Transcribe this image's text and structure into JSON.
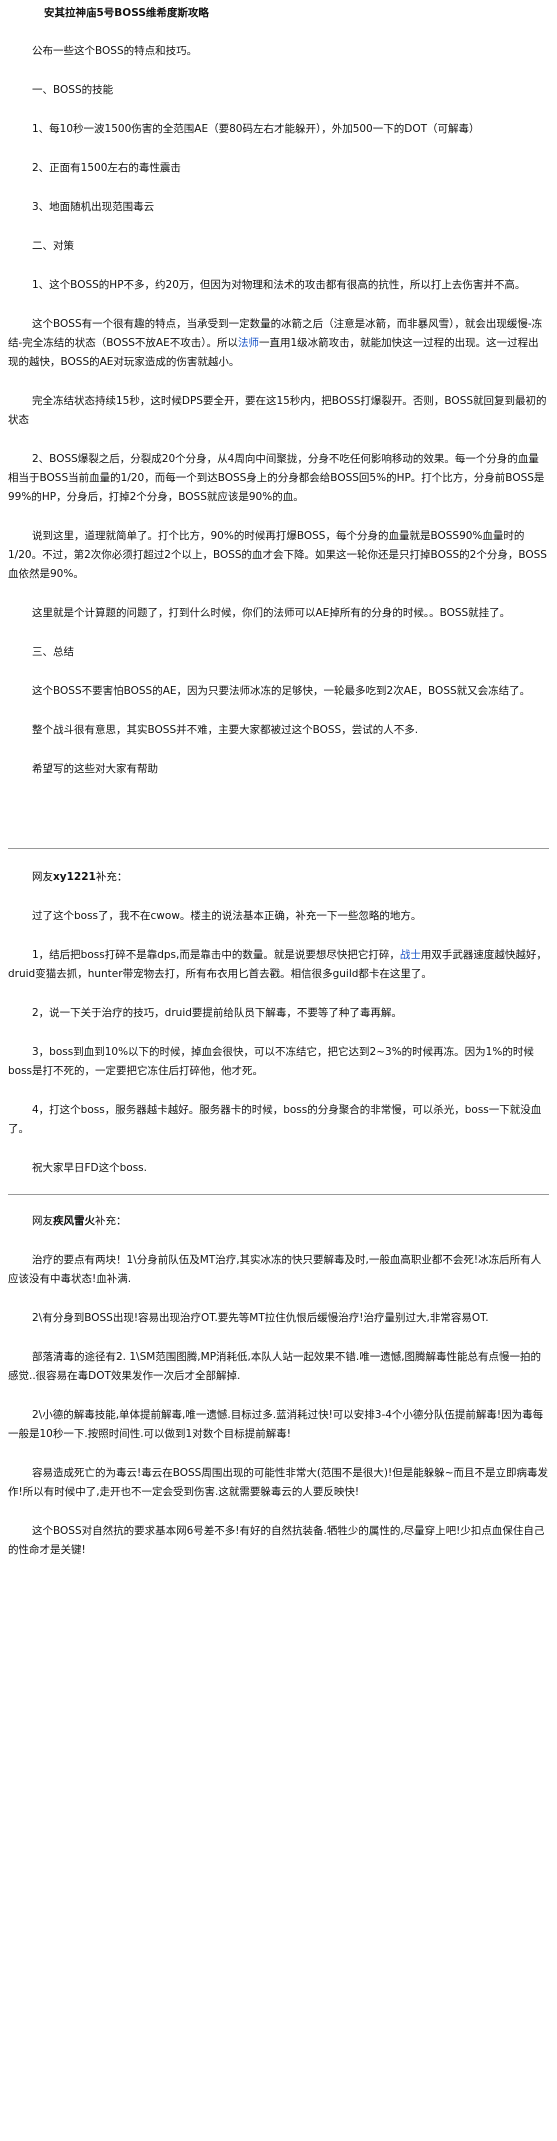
{
  "title": "安其拉神庙5号BOSS维希度斯攻略",
  "s1": {
    "intro": "公布一些这个BOSS的特点和技巧。",
    "h_skills": "一、BOSS的技能",
    "skill1": "1、每10秒一波1500伤害的全范围AE（要80码左右才能躲开），外加500一下的DOT（可解毒）",
    "skill2": "2、正面有1500左右的毒性震击",
    "skill3": "3、地面随机出现范围毒云",
    "h_strategy": "二、对策",
    "st1": "1、这个BOSS的HP不多，约20万，但因为对物理和法术的攻击都有很高的抗性，所以打上去伤害并不高。",
    "st2_a": "这个BOSS有一个很有趣的特点，当承受到一定数量的冰箭之后（注意是冰箭，而非暴风雪），就会出现缓慢-冻结-完全冻结的状态（BOSS不放AE不攻击）。所以",
    "st2_link": "法师",
    "st2_b": "一直用1级冰箭攻击，就能加快这一过程的出现。这一过程出现的越快，BOSS的AE对玩家造成的伤害就越小。",
    "st3": "完全冻结状态持续15秒，这时候DPS要全开，要在这15秒内，把BOSS打爆裂开。否则，BOSS就回复到最初的状态",
    "st4": "2、BOSS爆裂之后，分裂成20个分身，从4周向中间聚拢，分身不吃任何影响移动的效果。每一个分身的血量相当于BOSS当前血量的1/20，而每一个到达BOSS身上的分身都会给BOSS回5%的HP。打个比方，分身前BOSS是99%的HP，分身后，打掉2个分身，BOSS就应该是90%的血。",
    "st5": "说到这里，道理就简单了。打个比方，90%的时候再打爆BOSS，每个分身的血量就是BOSS90%血量时的1/20。不过，第2次你必须打超过2个以上，BOSS的血才会下降。如果这一轮你还是只打掉BOSS的2个分身，BOSS血依然是90%。",
    "st6": "这里就是个计算题的问题了，打到什么时候，你们的法师可以AE掉所有的分身的时候。。BOSS就挂了。",
    "h_summary": "三、总结",
    "sum1": "这个BOSS不要害怕BOSS的AE，因为只要法师冰冻的足够快，一轮最多吃到2次AE，BOSS就又会冻结了。",
    "sum2": "整个战斗很有意思，其实BOSS并不难，主要大家都被过这个BOSS，尝试的人不多.",
    "sum3": "希望写的这些对大家有帮助"
  },
  "s2": {
    "author_prefix": "网友",
    "author_name": "xy1221",
    "author_suffix": "补充：",
    "p1": "过了这个boss了，我不在cwow。楼主的说法基本正确，补充一下一些忽略的地方。",
    "p2_a": "1，结后把boss打碎不是靠dps,而是靠击中的数量。就是说要想尽快把它打碎，",
    "p2_link": "战士",
    "p2_b": "用双手武器速度越快越好，druid变猫去抓，hunter带宠物去打，所有布衣用匕首去戳。相信很多guild都卡在这里了。",
    "p3": "2，说一下关于治疗的技巧，druid要提前给队员下解毒，不要等了种了毒再解。",
    "p4": "3，boss到血到10%以下的时候，掉血会很快，可以不冻结它，把它达到2~3%的时候再冻。因为1%的时候boss是打不死的，一定要把它冻住后打碎他，他才死。",
    "p5": "4，打这个boss，服务器越卡越好。服务器卡的时候，boss的分身聚合的非常慢，可以杀光，boss一下就没血了。",
    "p6": "祝大家早日FD这个boss."
  },
  "s3": {
    "author_prefix": "网友",
    "author_name": "疾风雷火",
    "author_suffix": "补充：",
    "p1": "治疗的要点有两块！1\\分身前队伍及MT治疗,其实冰冻的快只要解毒及时,一般血高职业都不会死!冰冻后所有人应该没有中毒状态!血补满.",
    "p2": "2\\有分身到BOSS出现!容易出现治疗OT.要先等MT拉住仇恨后缓慢治疗!治疗量别过大,非常容易OT.",
    "p3": "部落清毒的途径有2. 1\\SM范围图腾,MP消耗低,本队人站一起效果不错.唯一遗憾,图腾解毒性能总有点慢一拍的感觉..很容易在毒DOT效果发作一次后才全部解掉.",
    "p4": "2\\小德的解毒技能,单体提前解毒,唯一遗憾.目标过多.蓝消耗过快!可以安排3-4个小德分队伍提前解毒!因为毒每一般是10秒一下.按照时间性.可以做到1对数个目标提前解毒!",
    "p5": "容易造成死亡的为毒云!毒云在BOSS周围出现的可能性非常大(范围不是很大)!但是能躲躲~而且不是立即病毒发作!所以有时候中了,走开也不一定会受到伤害.这就需要躲毒云的人要反映快!",
    "p6": "这个BOSS对自然抗的要求基本网6号差不多!有好的自然抗装备.牺牲少的属性的,尽量穿上吧!少扣点血保住自己的性命才是关键!"
  }
}
